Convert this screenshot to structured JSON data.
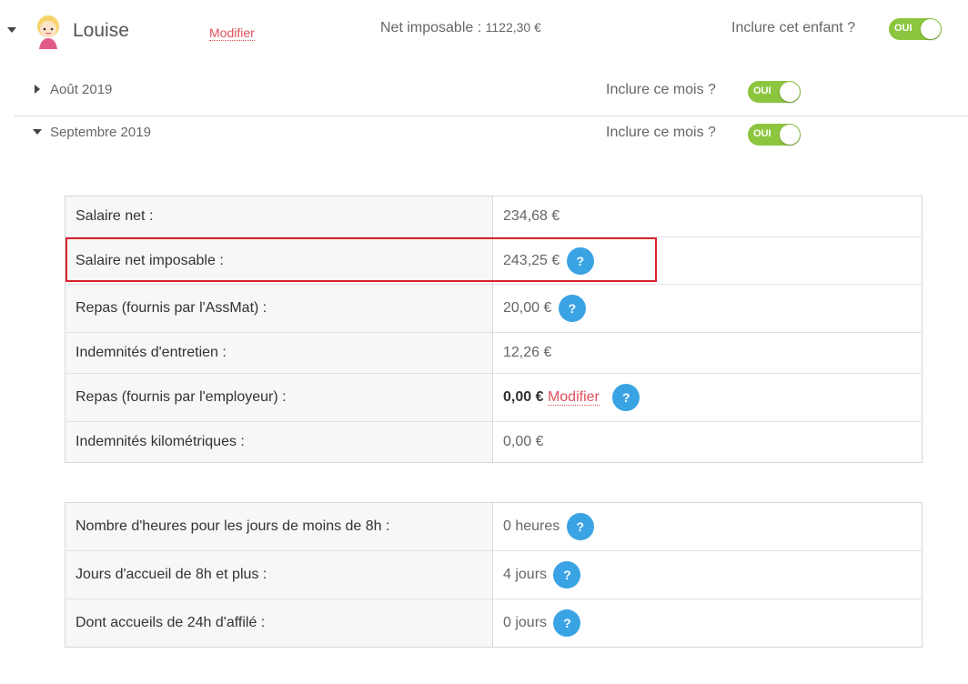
{
  "child": {
    "name": "Louise",
    "edit_link": "Modifier",
    "net_taxable_label": "Net imposable :",
    "net_taxable_value": "1122,30 €",
    "include_question": "Inclure cet enfant ?",
    "include_toggle": "OUI"
  },
  "months": [
    {
      "label": "Août 2019",
      "include_question": "Inclure ce mois ?",
      "toggle": "OUI",
      "expanded": false
    },
    {
      "label": "Septembre 2019",
      "include_question": "Inclure ce mois ?",
      "toggle": "OUI",
      "expanded": true
    }
  ],
  "salary_table": {
    "rows": [
      {
        "label": "Salaire net :",
        "value": "234,68 €"
      },
      {
        "label": "Salaire net imposable :",
        "value": "243,25 €",
        "help": "?"
      },
      {
        "label": "Repas (fournis par l'AssMat) :",
        "value": "20,00 €",
        "help": "?"
      },
      {
        "label": "Indemnités d'entretien :",
        "value": "12,26 €"
      },
      {
        "label": "Repas (fournis par l'employeur) :",
        "value": "0,00 €",
        "link": "Modifier",
        "help": "?"
      },
      {
        "label": "Indemnités kilométriques :",
        "value": "0,00 €"
      }
    ]
  },
  "hours_table": {
    "rows": [
      {
        "label": "Nombre d'heures pour les jours de moins de 8h :",
        "value": "0 heures",
        "help": "?"
      },
      {
        "label": "Jours d'accueil de 8h et plus :",
        "value": "4 jours",
        "help": "?"
      },
      {
        "label": "Dont accueils de 24h d'affilé :",
        "value": "0 jours",
        "help": "?"
      }
    ]
  },
  "colors": {
    "toggle_on": "#8cc63f",
    "help_bubble": "#3aa3e3",
    "link": "#e0505a",
    "highlight": "#d9232e"
  }
}
